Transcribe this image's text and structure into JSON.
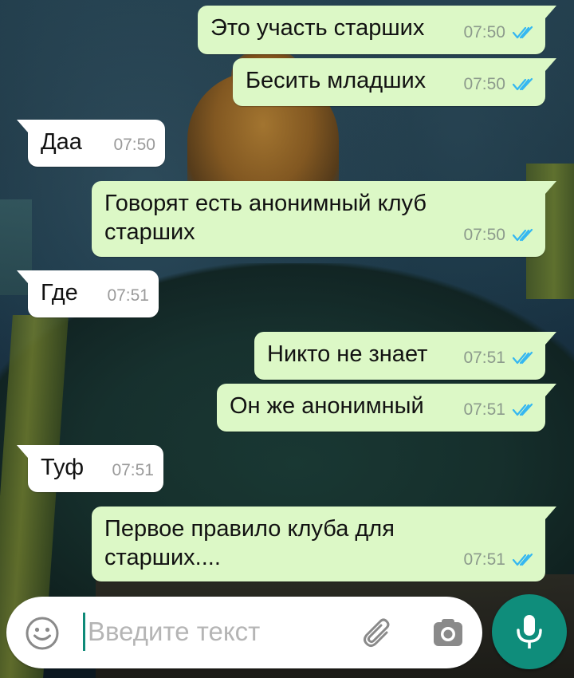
{
  "theme": {
    "outgoing_bubble": "#dcf8c6",
    "incoming_bubble": "#ffffff",
    "read_ticks": "#34b7f1",
    "accent": "#0f8d7b"
  },
  "messages": [
    {
      "direction": "out",
      "text": "Это участь старших",
      "time": "07:50",
      "status": "read"
    },
    {
      "direction": "out",
      "text": "Бесить младших",
      "time": "07:50",
      "status": "read"
    },
    {
      "direction": "in",
      "text": "Даа",
      "time": "07:50"
    },
    {
      "direction": "out",
      "text": "Говорят есть анонимный клуб старших",
      "time": "07:50",
      "status": "read"
    },
    {
      "direction": "in",
      "text": "Где",
      "time": "07:51"
    },
    {
      "direction": "out",
      "text": "Никто не знает",
      "time": "07:51",
      "status": "read"
    },
    {
      "direction": "out",
      "text": "Он же анонимный",
      "time": "07:51",
      "status": "read"
    },
    {
      "direction": "in",
      "text": "Туф",
      "time": "07:51"
    },
    {
      "direction": "out",
      "text": "Первое правило клуба для старших....",
      "time": "07:51",
      "status": "read"
    }
  ],
  "composer": {
    "placeholder": "Введите текст",
    "value": "",
    "icons": {
      "emoji": "emoji-icon",
      "attach": "paperclip-icon",
      "camera": "camera-icon",
      "mic": "microphone-icon"
    }
  }
}
